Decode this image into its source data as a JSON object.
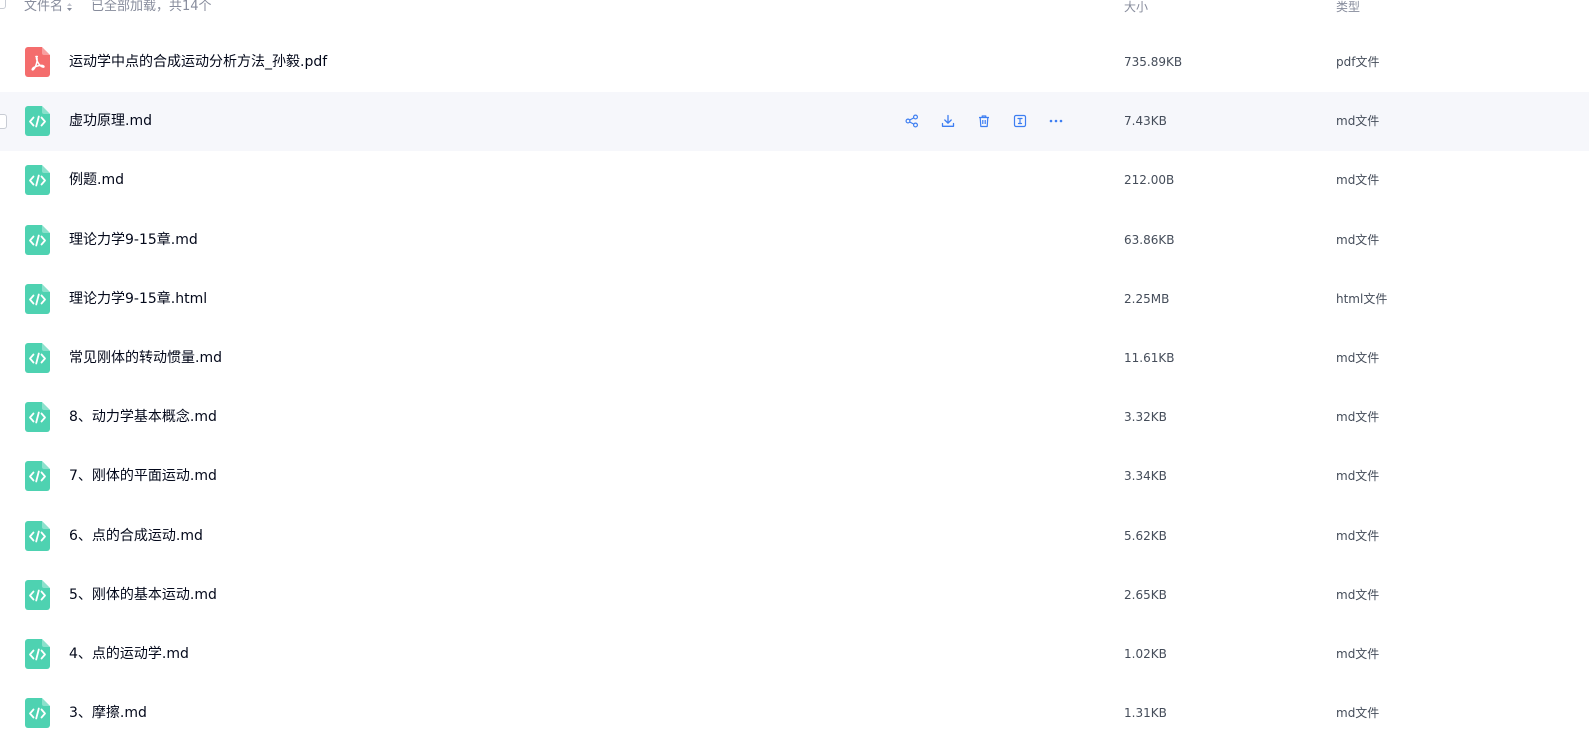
{
  "header": {
    "col_name": "文件名",
    "status": "已全部加载，共14个",
    "col_size": "大小",
    "col_type": "类型"
  },
  "colors": {
    "pdf_icon": "#f46d6d",
    "md_icon": "#4ed2b1",
    "action_icon": "#3d7ef2",
    "hover_row": "#f6f7fb"
  },
  "hover_actions": [
    {
      "icon": "share-icon"
    },
    {
      "icon": "download-icon"
    },
    {
      "icon": "delete-icon"
    },
    {
      "icon": "rename-icon"
    },
    {
      "icon": "more-icon"
    }
  ],
  "files": [
    {
      "name": "运动学中点的合成运动分析方法_孙毅.pdf",
      "size": "735.89KB",
      "type": "pdf文件",
      "icon": "pdf-file-icon"
    },
    {
      "name": "虚功原理.md",
      "size": "7.43KB",
      "type": "md文件",
      "icon": "code-file-icon"
    },
    {
      "name": "例题.md",
      "size": "212.00B",
      "type": "md文件",
      "icon": "code-file-icon"
    },
    {
      "name": "理论力学9-15章.md",
      "size": "63.86KB",
      "type": "md文件",
      "icon": "code-file-icon"
    },
    {
      "name": "理论力学9-15章.html",
      "size": "2.25MB",
      "type": "html文件",
      "icon": "code-file-icon"
    },
    {
      "name": "常见刚体的转动惯量.md",
      "size": "11.61KB",
      "type": "md文件",
      "icon": "code-file-icon"
    },
    {
      "name": "8、动力学基本概念.md",
      "size": "3.32KB",
      "type": "md文件",
      "icon": "code-file-icon"
    },
    {
      "name": "7、刚体的平面运动.md",
      "size": "3.34KB",
      "type": "md文件",
      "icon": "code-file-icon"
    },
    {
      "name": "6、点的合成运动.md",
      "size": "5.62KB",
      "type": "md文件",
      "icon": "code-file-icon"
    },
    {
      "name": "5、刚体的基本运动.md",
      "size": "2.65KB",
      "type": "md文件",
      "icon": "code-file-icon"
    },
    {
      "name": "4、点的运动学.md",
      "size": "1.02KB",
      "type": "md文件",
      "icon": "code-file-icon"
    },
    {
      "name": "3、摩擦.md",
      "size": "1.31KB",
      "type": "md文件",
      "icon": "code-file-icon"
    }
  ]
}
